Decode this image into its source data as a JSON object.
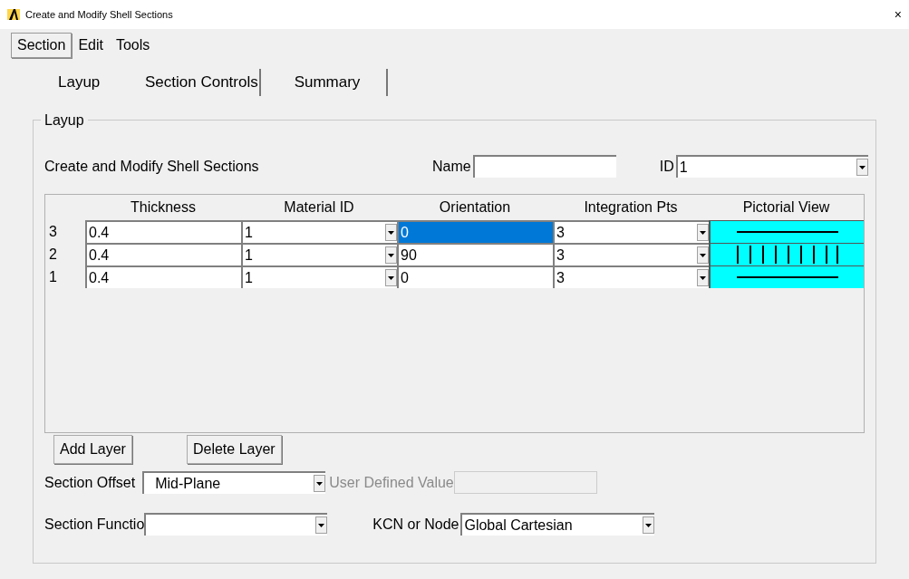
{
  "window": {
    "title": "Create and Modify Shell Sections",
    "close": "×"
  },
  "menu": [
    {
      "label": "Section",
      "selected": true
    },
    {
      "label": "Edit",
      "selected": false
    },
    {
      "label": "Tools",
      "selected": false
    }
  ],
  "tabs": [
    {
      "label": "Layup",
      "selected": true
    },
    {
      "label": "Section Controls",
      "selected": false
    },
    {
      "label": "Summary",
      "selected": false
    }
  ],
  "group": {
    "title": "Layup",
    "heading": "Create and Modify Shell Sections",
    "name_label": "Name",
    "id_label": "ID",
    "id_value": "1"
  },
  "table": {
    "columns": [
      "Thickness",
      "Material ID",
      "Orientation",
      "Integration Pts",
      "Pictorial View"
    ],
    "rows": [
      {
        "number": "3",
        "thickness": "0.4",
        "material": "1",
        "orientation": {
          "value": "0",
          "selected": true
        },
        "integration": "3",
        "kind": "horizontal"
      },
      {
        "number": "2",
        "thickness": "0.4",
        "material": "1",
        "orientation": {
          "value": "90",
          "selected": false
        },
        "integration": "3",
        "kind": "vertical"
      },
      {
        "number": "1",
        "thickness": "0.4",
        "material": "1",
        "orientation": {
          "value": "0",
          "selected": false
        },
        "integration": "3",
        "kind": "horizontal"
      }
    ]
  },
  "buttons": [
    "Add Layer",
    "Delete Layer"
  ],
  "section_offset": {
    "label": "Section Offset",
    "value": "Mid-Plane"
  },
  "user_defined": {
    "label": "User Defined Value",
    "disabled": true
  },
  "section_function": {
    "label": "Section Functio"
  },
  "kcn": {
    "label": "KCN or Node",
    "value": "Global Cartesian"
  }
}
